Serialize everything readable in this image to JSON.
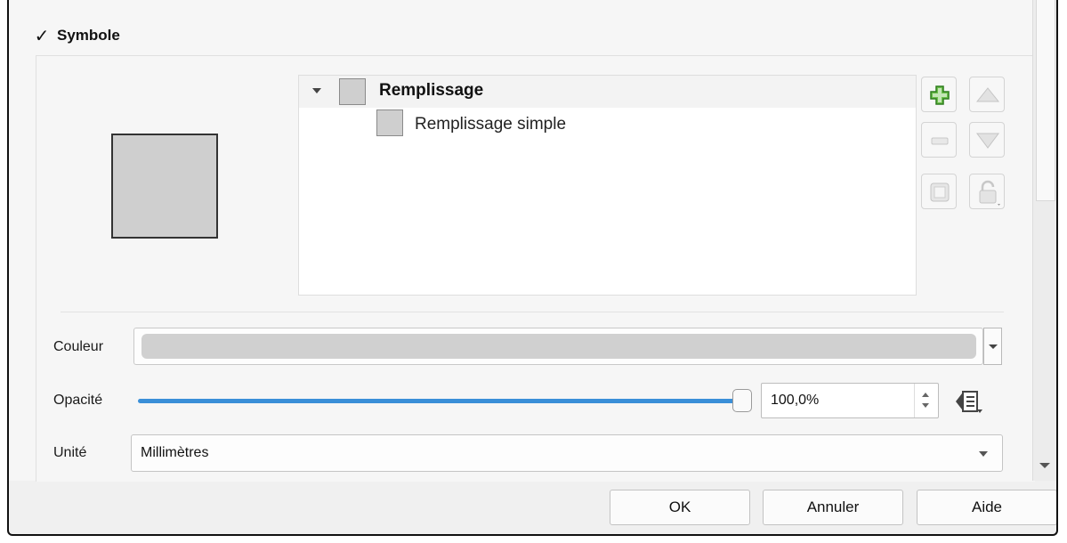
{
  "group": {
    "title": "Symbole",
    "checked": true,
    "check_glyph": "✓"
  },
  "symbol_tree": {
    "items": [
      {
        "label": "Remplissage",
        "expanded": true,
        "swatch_color": "#cfcfcf"
      },
      {
        "label": "Remplissage simple",
        "swatch_color": "#cfcfcf"
      }
    ]
  },
  "layer_buttons": {
    "add": "add-icon",
    "remove": "remove-icon",
    "duplicate": "duplicate-icon",
    "lock": "lock-icon",
    "move_up": "arrow-up-icon",
    "move_down": "arrow-down-icon"
  },
  "preview": {
    "fill_color": "#cfcfcf",
    "border_color": "#333333"
  },
  "color": {
    "label": "Couleur",
    "value": "#d0d0d0"
  },
  "opacity": {
    "label": "Opacité",
    "value": "100,0%",
    "fraction": 1.0,
    "accent": "#3a8fd8"
  },
  "unit": {
    "label": "Unité",
    "value": "Millimètres"
  },
  "dialog_buttons": {
    "ok": "OK",
    "cancel": "Annuler",
    "help": "Aide"
  }
}
